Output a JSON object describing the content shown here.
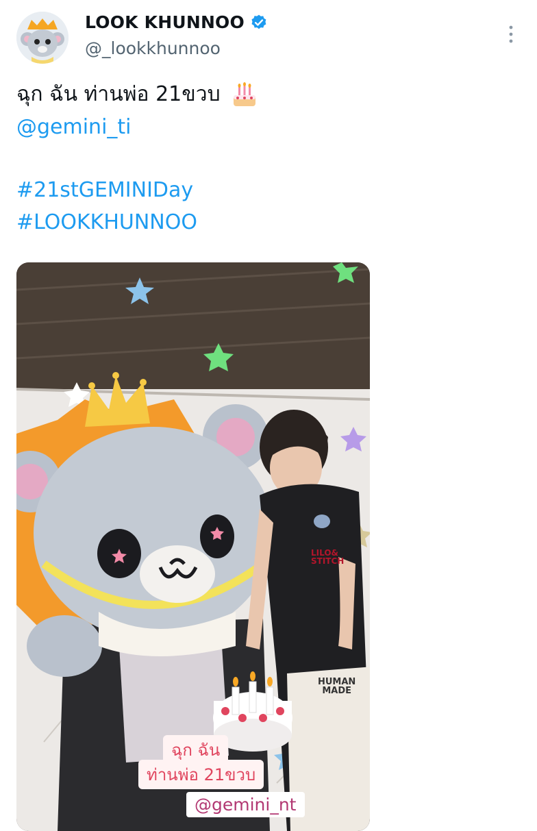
{
  "author": {
    "display_name": "LOOK KHUNNOO",
    "handle": "@_lookkhunnoo",
    "verified": true,
    "verified_color": "#1d9bf0"
  },
  "tweet": {
    "text": "ฉุก ฉัน ท่านพ่อ 21ขวบ",
    "emoji": "birthday-cake",
    "mention": "@gemini_ti",
    "hashtags": [
      "#21stGEMINIDay",
      "#LOOKKHUNNOO"
    ]
  },
  "media": {
    "sticker_line1": "ฉุก ฉัน",
    "sticker_line2": "ท่านพ่อ 21ขวบ",
    "sticker_handle": "@gemini_nt",
    "shirt_print_line1": "LILO&",
    "shirt_print_line2": "STITCH",
    "pants_print_line1": "HUMAN",
    "pants_print_line2": "MADE"
  },
  "colors": {
    "link": "#1d9bf0",
    "text": "#0f1419",
    "muted": "#536471"
  },
  "icons": [
    "avatar-mascot",
    "verified-badge-icon",
    "more-vertical-icon",
    "birthday-cake-emoji"
  ]
}
